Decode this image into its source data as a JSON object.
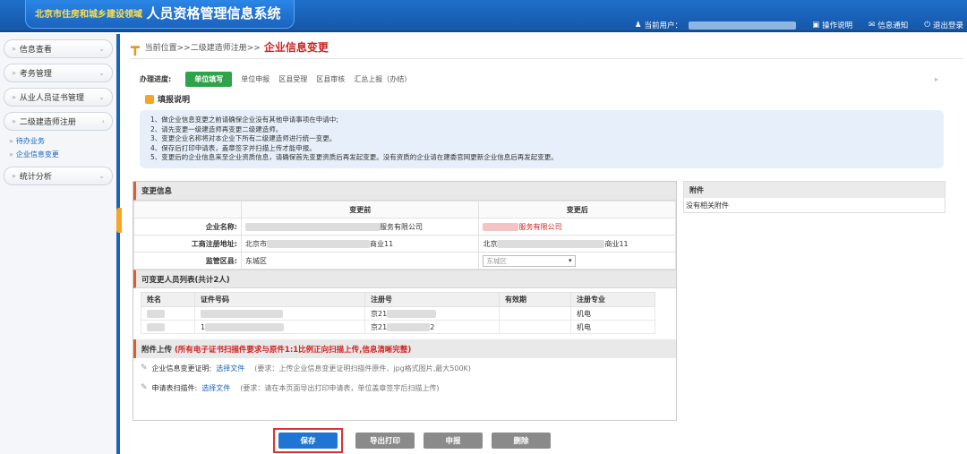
{
  "header": {
    "logo_small": "北京市住房和城乡建设领域",
    "logo_big": "人员资格管理信息系统",
    "current_user_label": "当前用户：",
    "ops_guide": "操作说明",
    "notifications": "信息通知",
    "logout": "退出登录"
  },
  "sidebar": {
    "items": [
      {
        "label": "信息查看"
      },
      {
        "label": "考务管理"
      },
      {
        "label": "从业人员证书管理"
      },
      {
        "label": "二级建造师注册"
      }
    ],
    "sub_items": [
      {
        "label": "待办业务"
      },
      {
        "label": "企业信息变更"
      }
    ],
    "stats": {
      "label": "统计分析"
    }
  },
  "breadcrumb": {
    "path": "当前位置>>二级建造师注册>>",
    "title": "企业信息变更"
  },
  "progress": {
    "label": "办理进度:",
    "steps": [
      "单位填写",
      "单位申报",
      "区县受理",
      "区县审核",
      "汇总上报（办结）"
    ]
  },
  "instructions": {
    "title": "填报说明",
    "lines": [
      "1、做企业信息变更之前请确保企业没有其他申请事项在申请中;",
      "2、请先变更一级建造师再变更二级建造师。",
      "3、变更企业名称将对本企业下所有二级建造师进行统一变更。",
      "4、保存后打印申请表，盖章签字并扫描上传才能申报。",
      "5、变更后的企业信息来至企业资质信息，请确保首先变更资质后再发起变更。没有资质的企业请在建委官网更新企业信息后再发起变更。"
    ]
  },
  "change_info": {
    "title": "变更信息",
    "before_header": "变更前",
    "after_header": "变更后",
    "rows": [
      {
        "label": "企业名称:",
        "before": "服务有限公司",
        "after": "服务有限公司"
      },
      {
        "label": "工商注册地址:",
        "before": "北京市",
        "before_tail": "商业11",
        "after": "北京",
        "after_tail": "商业11"
      },
      {
        "label": "监管区县:",
        "before": "东城区",
        "after": "东城区"
      }
    ]
  },
  "people": {
    "title": "可变更人员列表(共计2人)",
    "columns": [
      "姓名",
      "证件号码",
      "注册号",
      "有效期",
      "注册专业"
    ],
    "rows": [
      {
        "name": "",
        "id": "",
        "reg": "京21",
        "valid": "",
        "major": "机电"
      },
      {
        "name": "",
        "id": "1",
        "reg": "京21",
        "reg_tail": "2",
        "valid": "",
        "major": "机电"
      }
    ]
  },
  "upload": {
    "title": "附件上传",
    "requirement": "(所有电子证书扫描件要求与原件1:1比例正向扫描上传,信息清晰完整)",
    "rows": [
      {
        "label": "企业信息变更证明:",
        "link": "选择文件",
        "note": "(要求：上传企业信息变更证明扫描件原件、jpg格式图片,最大500K)"
      },
      {
        "label": "申请表扫描件:",
        "link": "选择文件",
        "note": "(要求：请在本页面导出打印申请表，单位盖章签字后扫描上传)"
      }
    ]
  },
  "attachments": {
    "title": "附件",
    "empty": "没有相关附件"
  },
  "buttons": {
    "save": "保存",
    "export": "导出打印",
    "submit": "申报",
    "delete": "删除"
  },
  "colors": {
    "header_blue": "#1e6fc9",
    "accent_red": "#d02020",
    "active_green": "#2fa34a",
    "primary_button": "#1f74d4"
  }
}
